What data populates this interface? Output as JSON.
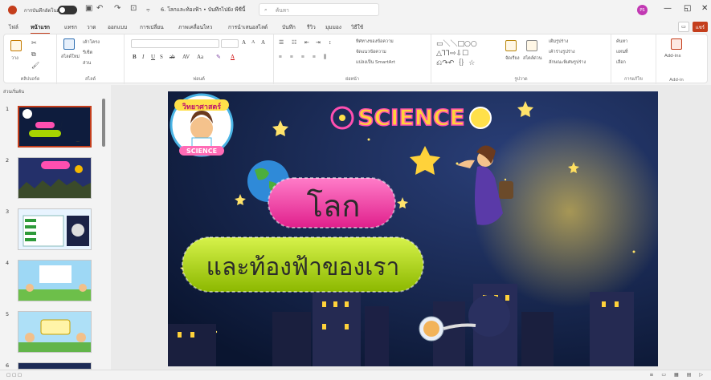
{
  "titlebar": {
    "autosave_label": "การบันทึกอัตโนมัติ",
    "doc_title": "6. โลกและท้องฟ้า • บันทึกไปยัง พีซีนี้",
    "search_placeholder": "ค้นหา",
    "user_initials": "PS"
  },
  "tabs": [
    {
      "label": "ไฟล์"
    },
    {
      "label": "หน้าแรก"
    },
    {
      "label": "แทรก"
    },
    {
      "label": "วาด"
    },
    {
      "label": "ออกแบบ"
    },
    {
      "label": "การเปลี่ยน"
    },
    {
      "label": "ภาพเคลื่อนไหว"
    },
    {
      "label": "การนำเสนอสไลด์"
    },
    {
      "label": "บันทึก"
    },
    {
      "label": "รีวิว"
    },
    {
      "label": "มุมมอง"
    },
    {
      "label": "วิธีใช้"
    }
  ],
  "share_label": "แชร์",
  "ribbon": {
    "paste": "วาง",
    "clipboard": "คลิปบอร์ด",
    "new_slide": "สไลด์ใหม่",
    "layout": "เค้าโครง",
    "reset": "รีเซ็ต",
    "section": "ส่วน",
    "slides": "สไลด์",
    "font": "ฟอนต์",
    "paragraph": "ย่อหน้า",
    "text_direction": "ทิศทางของข้อความ",
    "align_text": "จัดแนวข้อความ",
    "convert_smartart": "แปลงเป็น SmartArt",
    "arrange": "จัดเรียง",
    "quick_styles": "สไตล์ด่วน",
    "shape_fill": "เติมรูปร่าง",
    "shape_outline": "เค้าร่างรูปร่าง",
    "shape_effects": "ลักษณะพิเศษรูปร่าง",
    "drawing": "รูปวาด",
    "find": "ค้นหา",
    "replace": "แทนที่",
    "select": "เลือก",
    "editing": "การแก้ไข",
    "addins": "Add-ins",
    "addin_group": "Add-in"
  },
  "sidebar": {
    "heading": "ส่วนเริ่มต้น",
    "slide_numbers": [
      "1",
      "2",
      "3",
      "4",
      "5",
      "6"
    ]
  },
  "slide": {
    "badge": "วิทยาศาสตร์",
    "badge_sub": "SCIENCE",
    "logo_text": "SCIENCE",
    "title": "โลก",
    "subtitle": "และท้องฟ้าของเรา"
  },
  "colors": {
    "accent": "#c43e1c",
    "sky": "#0c1a3a",
    "moon": "#f5b800",
    "pink_pill": "#ff4fb0",
    "green_pill": "#a8d400"
  }
}
